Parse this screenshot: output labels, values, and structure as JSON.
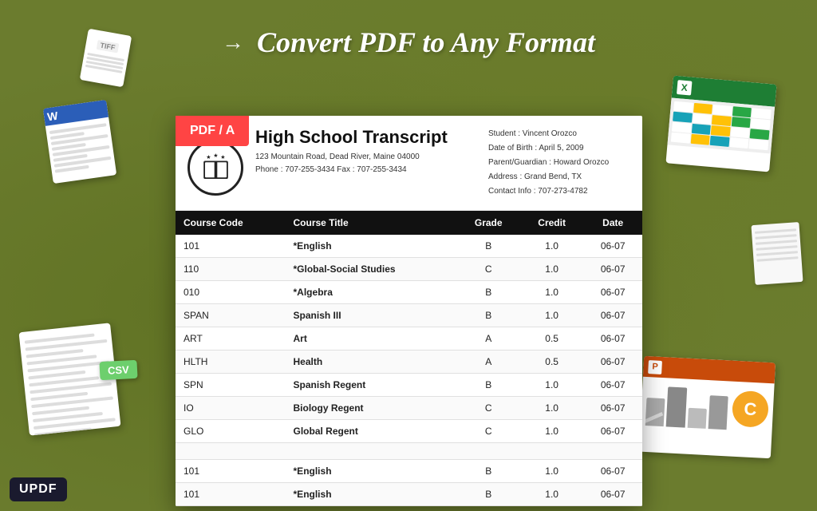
{
  "page": {
    "title": "Convert PDF to Any Format",
    "background_color": "#6b7c2e"
  },
  "header": {
    "title": "Convert PDF to Any Format"
  },
  "pdf_badge": "PDF / A",
  "document": {
    "title": "High School Transcript",
    "address_line1": "123 Mountain Road, Dead River, Maine 04000",
    "address_line2": "Phone : 707-255-3434    Fax : 707-255-3434",
    "student_name": "Student : Vincent Orozco",
    "dob": "Date of Birth : April 5, 2009",
    "parent": "Parent/Guardian : Howard Orozco",
    "address": "Address : Grand Bend, TX",
    "contact": "Contact Info : 707-273-4782"
  },
  "table": {
    "headers": [
      "Course Code",
      "Course Title",
      "Grade",
      "Credit",
      "Date"
    ],
    "rows": [
      {
        "code": "101",
        "title": "*English",
        "grade": "B",
        "credit": "1.0",
        "date": "06-07"
      },
      {
        "code": "110",
        "title": "*Global-Social Studies",
        "grade": "C",
        "credit": "1.0",
        "date": "06-07"
      },
      {
        "code": "010",
        "title": "*Algebra",
        "grade": "B",
        "credit": "1.0",
        "date": "06-07"
      },
      {
        "code": "SPAN",
        "title": "Spanish III",
        "grade": "B",
        "credit": "1.0",
        "date": "06-07"
      },
      {
        "code": "ART",
        "title": "Art",
        "grade": "A",
        "credit": "0.5",
        "date": "06-07"
      },
      {
        "code": "HLTH",
        "title": "Health",
        "grade": "A",
        "credit": "0.5",
        "date": "06-07"
      },
      {
        "code": "SPN",
        "title": "Spanish Regent",
        "grade": "B",
        "credit": "1.0",
        "date": "06-07"
      },
      {
        "code": "IO",
        "title": "Biology Regent",
        "grade": "C",
        "credit": "1.0",
        "date": "06-07"
      },
      {
        "code": "GLO",
        "title": "Global Regent",
        "grade": "C",
        "credit": "1.0",
        "date": "06-07"
      },
      {
        "code": "",
        "title": "",
        "grade": "",
        "credit": "",
        "date": ""
      },
      {
        "code": "101",
        "title": "*English",
        "grade": "B",
        "credit": "1.0",
        "date": "06-07"
      },
      {
        "code": "101",
        "title": "*English",
        "grade": "B",
        "credit": "1.0",
        "date": "06-07"
      }
    ]
  },
  "logos": {
    "word": "W",
    "excel": "X",
    "ppt": "P",
    "csv": "CSV",
    "updf": "UPDF",
    "tiff": "TIFF"
  }
}
